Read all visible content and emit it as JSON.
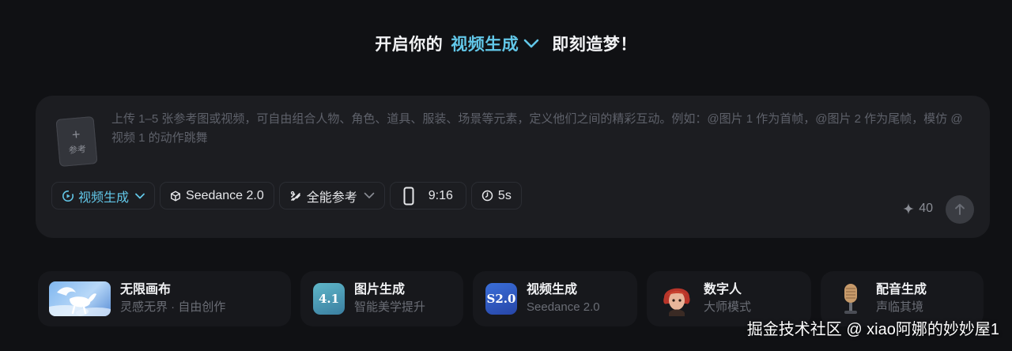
{
  "headline": {
    "prefix": "开启你的",
    "mode": "视频生成",
    "suffix": "即刻造梦！"
  },
  "composer": {
    "reference_label": "参考",
    "prompt_placeholder": "上传 1–5 张参考图或视频，可自由组合人物、角色、道具、服装、场景等元素，定义他们之间的精彩互动。例如：@图片 1 作为首帧，@图片 2 作为尾帧，模仿 @视频 1 的动作跳舞",
    "toolbar": {
      "mode_label": "视频生成",
      "model_label": "Seedance 2.0",
      "reference_mode_label": "全能参考",
      "ratio_label": "9:16",
      "duration_label": "5s"
    },
    "credits": "40"
  },
  "features": [
    {
      "title": "无限画布",
      "subtitle": "灵感无界 · 自由创作"
    },
    {
      "title": "图片生成",
      "subtitle": "智能美学提升",
      "badge": "4.1"
    },
    {
      "title": "视频生成",
      "subtitle": "Seedance 2.0",
      "badge": "S2.0"
    },
    {
      "title": "数字人",
      "subtitle": "大师模式"
    },
    {
      "title": "配音生成",
      "subtitle": "声临其境"
    }
  ],
  "watermark": "掘金技术社区 @ xiao阿娜的妙妙屋1",
  "colors": {
    "background": "#101114",
    "panel": "#1c1d21",
    "accent": "#62c7e8",
    "muted_text": "#5e616a"
  },
  "icons": {
    "mode_chevron": "chevron-down-icon",
    "video_mode": "play-circle-icon",
    "model": "cube-icon",
    "reference_mode": "link-icon",
    "ratio": "portrait-rect-icon",
    "duration": "clock-icon",
    "credits": "sparkle-icon",
    "send": "arrow-up-icon"
  }
}
